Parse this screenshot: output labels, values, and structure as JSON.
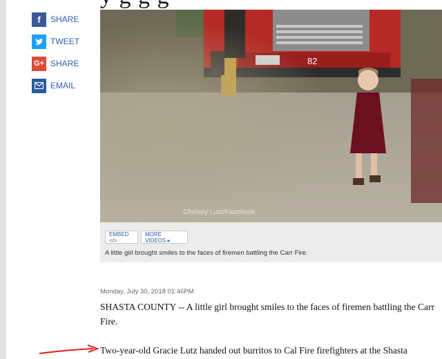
{
  "share": [
    {
      "icon": "facebook-icon",
      "glyph": "f",
      "color": "#3b5998",
      "label": "SHARE"
    },
    {
      "icon": "twitter-icon",
      "glyph": "🐦",
      "color": "#1da1f2",
      "label": "TWEET"
    },
    {
      "icon": "google-plus-icon",
      "glyph": "G+",
      "color": "#dd4b39",
      "label": "SHARE"
    },
    {
      "icon": "email-icon",
      "glyph": "✉",
      "color": "#2b5aa0",
      "label": "EMAIL"
    }
  ],
  "video": {
    "truck_number": "82",
    "watermark": "Chelsey Lutz/Facebook",
    "embed_label": "EMBED </>",
    "more_label": "MORE VIDEOS ▸",
    "caption": "A little girl brought smiles to the faces of firemen battling the Carr Fire."
  },
  "article": {
    "timestamp": "Monday, July 30, 2018 01:46PM",
    "para1": "SHASTA COUNTY -- A little girl brought smiles to the faces of firemen battling the Carr Fire.",
    "para2": "Two-year-old Gracie Lutz handed out burritos to Cal Fire firefighters at the Shasta"
  },
  "colors": {
    "link": "#2b5fb4",
    "annotation_arrow": "#e0201b"
  }
}
